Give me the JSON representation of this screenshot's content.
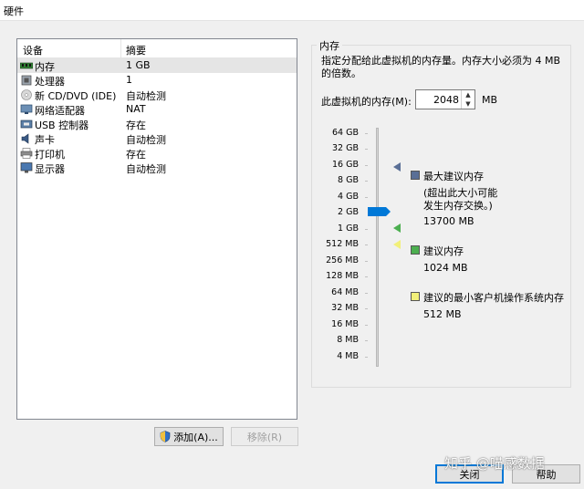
{
  "window": {
    "title": "硬件"
  },
  "device_list": {
    "col_device": "设备",
    "col_summary": "摘要",
    "rows": [
      {
        "name": "内存",
        "summary": "1 GB",
        "icon": "memory-icon"
      },
      {
        "name": "处理器",
        "summary": "1",
        "icon": "processor-icon"
      },
      {
        "name": "新 CD/DVD (IDE)",
        "summary": "自动检测",
        "icon": "cd-dvd-icon"
      },
      {
        "name": "网络适配器",
        "summary": "NAT",
        "icon": "network-adapter-icon"
      },
      {
        "name": "USB 控制器",
        "summary": "存在",
        "icon": "usb-controller-icon"
      },
      {
        "name": "声卡",
        "summary": "自动检测",
        "icon": "sound-card-icon"
      },
      {
        "name": "打印机",
        "summary": "存在",
        "icon": "printer-icon"
      },
      {
        "name": "显示器",
        "summary": "自动检测",
        "icon": "display-icon"
      }
    ]
  },
  "buttons": {
    "add": "添加(A)...",
    "remove": "移除(R)",
    "close": "关闭",
    "help": "帮助"
  },
  "memory": {
    "group_title": "内存",
    "description": "指定分配给此虚拟机的内存量。内存大小必须为 4 MB 的倍数。",
    "field_label": "此虚拟机的内存(M):",
    "value": "2048",
    "unit": "MB",
    "scale": [
      "64 GB",
      "32 GB",
      "16 GB",
      "8 GB",
      "4 GB",
      "2 GB",
      "1 GB",
      "512 MB",
      "256 MB",
      "128 MB",
      "64 MB",
      "32 MB",
      "16 MB",
      "8 MB",
      "4 MB"
    ],
    "max_recommended": {
      "title": "最大建议内存",
      "note": "(超出此大小可能发生内存交换。)",
      "value": "13700 MB"
    },
    "recommended": {
      "title": "建议内存",
      "value": "1024 MB"
    },
    "min_recommended": {
      "title": "建议的最小客户机操作系统内存",
      "value": "512 MB"
    }
  },
  "watermark": "知乎 @喵感数据",
  "colors": {
    "accent": "#0078d7",
    "max_marker": "#5a6f96",
    "recommended": "#4caf50",
    "min_recommended": "#f2f07a"
  }
}
